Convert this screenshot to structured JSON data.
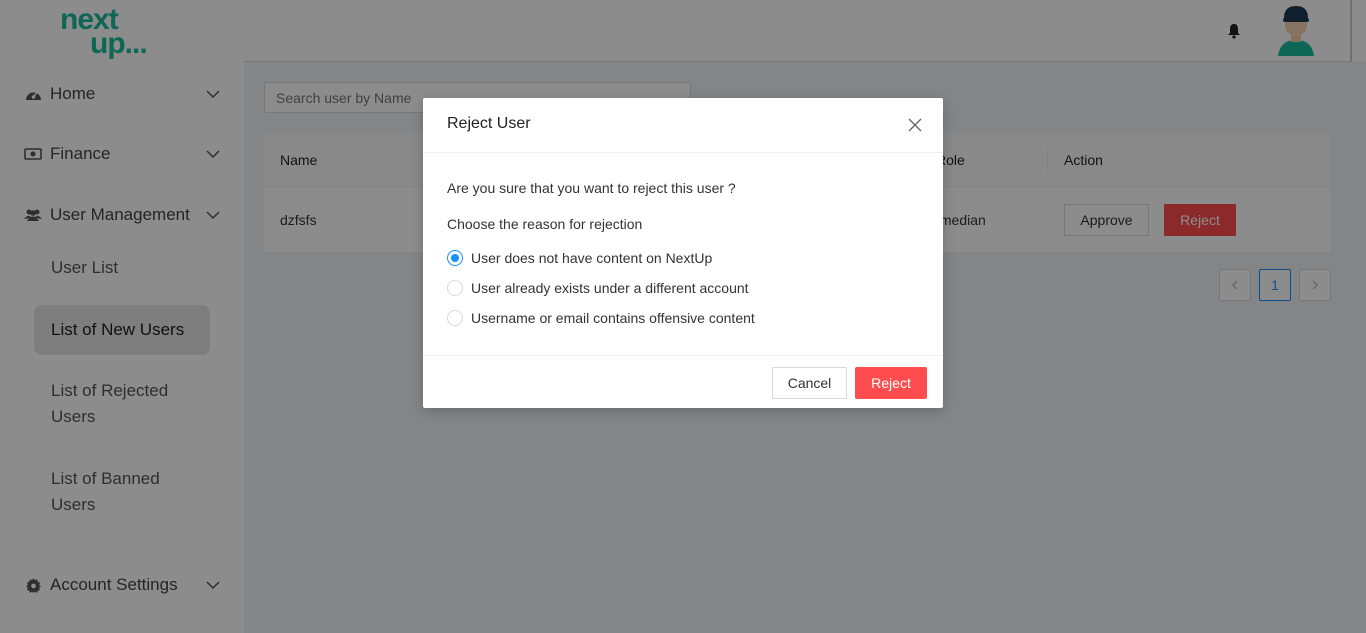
{
  "brand": {
    "logo_line1": "next",
    "logo_line2": "up..."
  },
  "sidebar": {
    "items": [
      {
        "label": "Home",
        "icon": "dashboard-icon"
      },
      {
        "label": "Finance",
        "icon": "money-icon"
      },
      {
        "label": "User Management",
        "icon": "users-icon"
      },
      {
        "label": "Account Settings",
        "icon": "gear-icon"
      }
    ],
    "sub_items": [
      {
        "label": "User List"
      },
      {
        "label": "List of New Users"
      },
      {
        "label": "List of Rejected Users"
      },
      {
        "label": "List of Banned Users"
      }
    ]
  },
  "header": {
    "bell_icon": "bell-icon",
    "avatar_icon": "avatar-icon"
  },
  "main": {
    "search": {
      "placeholder": "Search user by Name"
    },
    "table": {
      "columns": [
        "Name",
        "Role",
        "Action"
      ],
      "rows": [
        {
          "name": "dzfsfs",
          "role": "Comedian",
          "approve_label": "Approve",
          "reject_label": "Reject"
        }
      ]
    },
    "pagination": {
      "current_page": "1",
      "prev_icon": "chevron-left-icon",
      "next_icon": "chevron-right-icon"
    }
  },
  "modal": {
    "title": "Reject User",
    "question": "Are you sure that you want to reject this user ?",
    "reason_label": "Choose the reason for rejection",
    "reasons": [
      {
        "label": "User does not have content on NextUp",
        "checked": true
      },
      {
        "label": "User already exists under a different account",
        "checked": false
      },
      {
        "label": "Username or email contains offensive content",
        "checked": false
      }
    ],
    "cancel_label": "Cancel",
    "reject_label": "Reject"
  },
  "colors": {
    "accent": "#1890ff",
    "danger": "#ff4d4f",
    "brand": "#1abc9c"
  }
}
